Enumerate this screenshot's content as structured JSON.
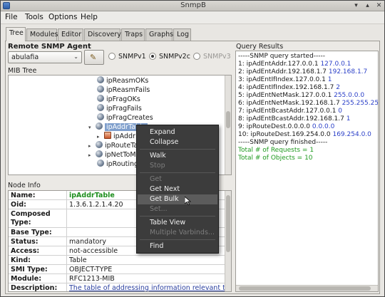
{
  "window": {
    "title": "SnmpB",
    "minimize_glyph": "▾",
    "maximize_glyph": "▴",
    "close_glyph": "✕"
  },
  "menu": [
    "File",
    "Tools",
    "Options",
    "Help"
  ],
  "tabs": [
    "Tree",
    "Modules",
    "Editor",
    "Discovery",
    "Traps",
    "Graphs",
    "Log"
  ],
  "agent": {
    "label": "Remote SNMP Agent",
    "selected": "abulafia",
    "select_arrow": "⌄",
    "config_icon_glyph": "✎",
    "versions": [
      {
        "label": "SNMPv1",
        "selected": false,
        "disabled": false
      },
      {
        "label": "SNMPv2c",
        "selected": true,
        "disabled": false
      },
      {
        "label": "SNMPv3",
        "selected": false,
        "disabled": true
      }
    ]
  },
  "mib_tree": {
    "label": "MIB Tree",
    "items": [
      {
        "label": "ipReasmOKs",
        "icon": "leaf-node-icon"
      },
      {
        "label": "ipReasmFails",
        "icon": "leaf-node-icon"
      },
      {
        "label": "ipFragOKs",
        "icon": "leaf-node-icon"
      },
      {
        "label": "ipFragFails",
        "icon": "leaf-node-icon"
      },
      {
        "label": "ipFragCreates",
        "icon": "leaf-node-icon"
      },
      {
        "label": "ipAddrTable",
        "icon": "leaf-node-icon",
        "expander": "▾",
        "selected": true
      },
      {
        "label": "ipAddr",
        "icon": "table-icon",
        "expander": "▸"
      },
      {
        "label": "ipRouteTa",
        "icon": "leaf-node-icon",
        "expander": "▸"
      },
      {
        "label": "ipNetToMe",
        "icon": "leaf-node-icon",
        "expander": "▸"
      },
      {
        "label": "ipRoutingD",
        "icon": "leaf-node-icon"
      }
    ]
  },
  "node_info": {
    "label": "Node Info",
    "rows": [
      {
        "key": "Name:",
        "value": "ipAddrTable",
        "style": "green"
      },
      {
        "key": "Oid:",
        "value": "1.3.6.1.2.1.4.20"
      },
      {
        "key": "Composed Type:",
        "value": ""
      },
      {
        "key": "Base Type:",
        "value": ""
      },
      {
        "key": "Status:",
        "value": "mandatory"
      },
      {
        "key": "Access:",
        "value": "not-accessible"
      },
      {
        "key": "Kind:",
        "value": "Table"
      },
      {
        "key": "SMI Type:",
        "value": "OBJECT-TYPE"
      },
      {
        "key": "Module:",
        "value": "RFC1213-MIB"
      },
      {
        "key": "Description:",
        "value": "The table of addressing information relevant to",
        "style": "link"
      }
    ]
  },
  "query_results": {
    "label": "Query Results",
    "lines": [
      {
        "text": "-----SNMP query started-----",
        "value": ""
      },
      {
        "text": "1: ipAdEntAddr.127.0.0.1 ",
        "value": "127.0.0.1"
      },
      {
        "text": "2: ipAdEntAddr.192.168.1.7 ",
        "value": "192.168.1.7"
      },
      {
        "text": "3: ipAdEntIfIndex.127.0.0.1 ",
        "value": "1"
      },
      {
        "text": "4: ipAdEntIfIndex.192.168.1.7 ",
        "value": "2"
      },
      {
        "text": "5: ipAdEntNetMask.127.0.0.1 ",
        "value": "255.0.0.0"
      },
      {
        "text": "6: ipAdEntNetMask.192.168.1.7 ",
        "value": "255.255.255"
      },
      {
        "text": "7: ipAdEntBcastAddr.127.0.0.1 ",
        "value": "0"
      },
      {
        "text": "8: ipAdEntBcastAddr.192.168.1.7 ",
        "value": "1"
      },
      {
        "text": "9: ipRouteDest.0.0.0.0 ",
        "value": "0.0.0.0"
      },
      {
        "text": "10: ipRouteDest.169.254.0.0 ",
        "value": "169.254.0.0"
      },
      {
        "text": "-----SNMP query finished-----",
        "value": ""
      },
      {
        "text": "Total # of Requests = 1",
        "value": "",
        "style": "green"
      },
      {
        "text": "Total # of Objects = 10",
        "value": "",
        "style": "green"
      }
    ]
  },
  "context_menu": {
    "items": [
      {
        "label": "Expand",
        "disabled": false
      },
      {
        "label": "Collapse",
        "disabled": false
      },
      {
        "label": "Walk",
        "disabled": false
      },
      {
        "label": "Stop",
        "disabled": true
      },
      {
        "label": "Get",
        "disabled": true
      },
      {
        "label": "Get Next",
        "disabled": false
      },
      {
        "label": "Get Bulk",
        "disabled": false,
        "highlighted": true
      },
      {
        "label": "Set...",
        "disabled": true
      },
      {
        "label": "Table View",
        "disabled": false
      },
      {
        "label": "Multiple Varbinds...",
        "disabled": true
      },
      {
        "label": "Find",
        "disabled": false
      }
    ]
  }
}
